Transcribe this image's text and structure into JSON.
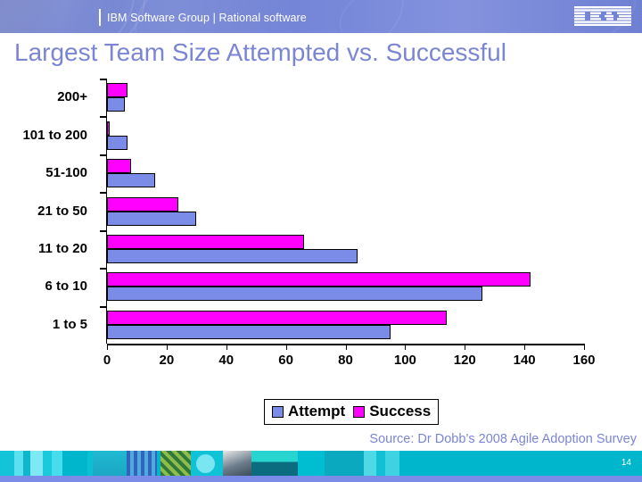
{
  "header": {
    "title": "IBM Software Group | Rational software",
    "logo_alt": "IBM",
    "brand_color": "#7a86d4"
  },
  "slide": {
    "title": "Largest Team Size Attempted vs. Successful",
    "source_note": "Source: Dr Dobb’s 2008 Agile Adoption Survey",
    "page_number": "14"
  },
  "chart_data": {
    "type": "bar",
    "orientation": "horizontal",
    "title": "Largest Team Size Attempted vs. Successful",
    "xlabel": "",
    "ylabel": "",
    "xlim": [
      0,
      160
    ],
    "xticks": [
      0,
      20,
      40,
      60,
      80,
      100,
      120,
      140,
      160
    ],
    "xticklabels": [
      "0",
      "20",
      "40",
      "60",
      "80",
      "100",
      "120",
      "140",
      "160"
    ],
    "grid": false,
    "legend_position": "bottom",
    "categories": [
      "1 to 5",
      "6 to 10",
      "11 to 20",
      "21 to 50",
      "51-100",
      "101 to 200",
      "200+"
    ],
    "series": [
      {
        "name": "Attempt",
        "color": "#7b8ce8",
        "values": [
          95,
          126,
          84,
          30,
          16,
          7,
          6
        ]
      },
      {
        "name": "Success",
        "color": "#ff00ff",
        "values": [
          114,
          142,
          66,
          24,
          8,
          1,
          7
        ]
      }
    ]
  },
  "legend": {
    "items": [
      {
        "label": "Attempt",
        "color": "#7b8ce8"
      },
      {
        "label": "Success",
        "color": "#ff00ff"
      }
    ]
  }
}
